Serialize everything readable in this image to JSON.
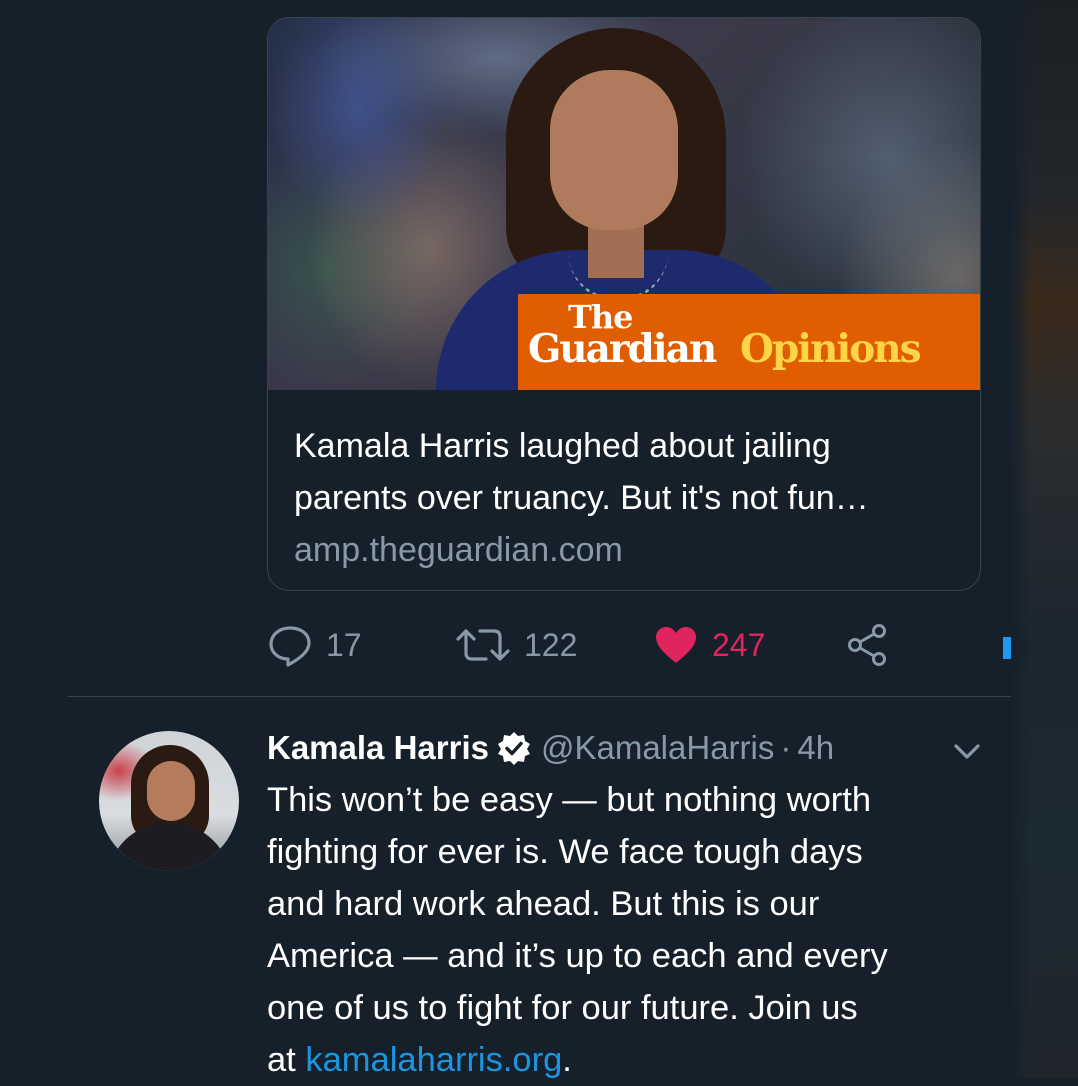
{
  "card": {
    "image_brand": {
      "the": "The",
      "guardian": "Guardian",
      "opinions": "Opinions"
    },
    "title_line1": "Kamala Harris laughed about jailing",
    "title_line2": "parents over truancy. But it's not fun…",
    "domain": "amp.theguardian.com"
  },
  "actions": {
    "reply_count": "17",
    "retweet_count": "122",
    "like_count": "247"
  },
  "tweet": {
    "name": "Kamala Harris",
    "handle": "@KamalaHarris",
    "separator": "·",
    "time": "4h",
    "lines": [
      "This won’t be easy — but nothing worth",
      "fighting for ever is. We face tough days",
      "and hard work ahead. But this is our",
      "America — and it’s up to each and every",
      "one of us to fight for our future. Join us"
    ],
    "last_line_prefix": "at ",
    "link_text": "kamalaharris.org",
    "last_line_suffix": "."
  },
  "colors": {
    "background": "#15202b",
    "border": "#38444d",
    "secondary_text": "#8899a6",
    "like": "#e0245e",
    "link": "#1b95e0",
    "guardian_orange": "#e05e00",
    "opinions_yellow": "#ffd447"
  },
  "icons": [
    "reply-icon",
    "retweet-icon",
    "heart-icon",
    "share-icon",
    "verified-badge-icon",
    "chevron-down-icon"
  ]
}
